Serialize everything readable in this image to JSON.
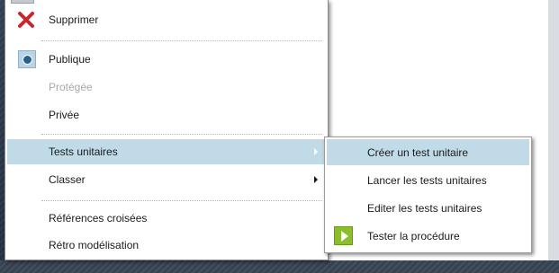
{
  "context_menu": {
    "items": [
      {
        "label": "Supprimer",
        "icon": "delete-x-icon"
      },
      {
        "label": "Publique",
        "icon": "radio-selected-icon",
        "selected": true
      },
      {
        "label": "Protégée",
        "disabled": true
      },
      {
        "label": "Privée"
      },
      {
        "label": "Tests unitaires",
        "has_submenu": true,
        "highlighted": true
      },
      {
        "label": "Classer",
        "has_submenu": true
      },
      {
        "label": "Références croisées"
      },
      {
        "label": "Rétro modélisation"
      }
    ]
  },
  "submenu": {
    "items": [
      {
        "label": "Créer un test unitaire",
        "highlighted": true
      },
      {
        "label": "Lancer les tests unitaires"
      },
      {
        "label": "Editer les tests unitaires"
      },
      {
        "label": "Tester la procédure",
        "icon": "play-icon"
      }
    ]
  },
  "colors": {
    "highlight": "#c1dae8",
    "delete_icon": "#c8282d",
    "play_icon": "#8cbe2c",
    "disabled_text": "#a8a8a8"
  }
}
